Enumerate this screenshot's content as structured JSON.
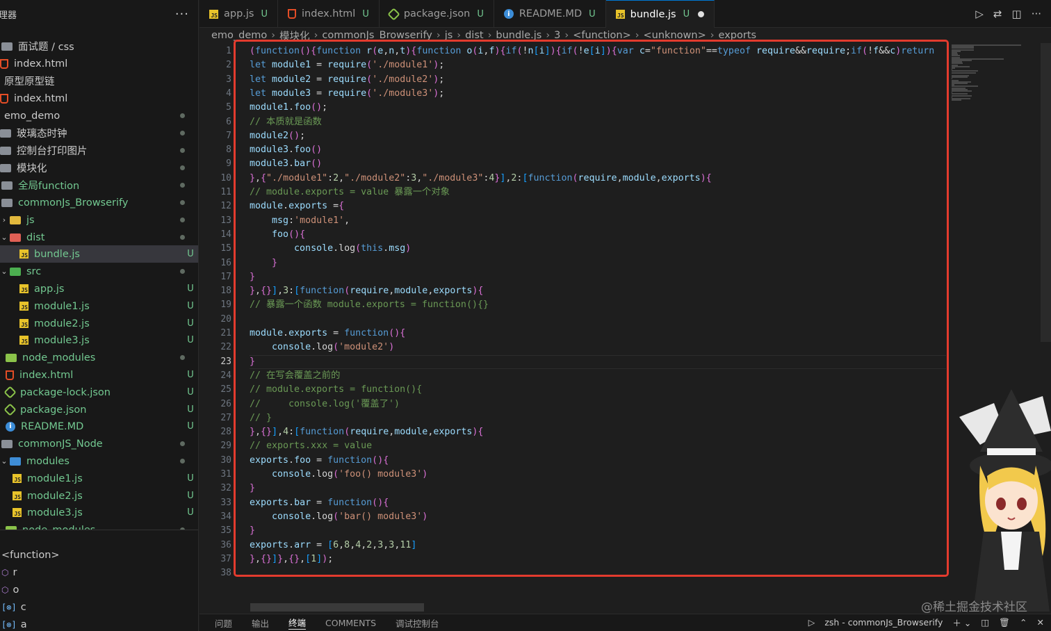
{
  "sidebar": {
    "title": "理器",
    "more": "···",
    "rows": [
      {
        "label": "面试题 / css",
        "icon": "folder-icon",
        "status": "",
        "type": "folder"
      },
      {
        "label": "index.html",
        "icon": "html-icon",
        "status": "",
        "type": "file"
      },
      {
        "label": "原型原型链",
        "icon": "",
        "status": "",
        "type": "folder"
      },
      {
        "label": "index.html",
        "icon": "html-icon",
        "status": "",
        "type": "file"
      },
      {
        "label": "emo_demo",
        "icon": "",
        "status": "dot",
        "type": "folder"
      },
      {
        "label": "玻璃态时钟",
        "icon": "folder-icon",
        "status": "dot",
        "type": "folder"
      },
      {
        "label": "控制台打印图片",
        "icon": "folder-icon",
        "status": "dot",
        "type": "folder"
      },
      {
        "label": "模块化",
        "icon": "folder-icon",
        "status": "dot",
        "type": "folder"
      },
      {
        "label": "全局function",
        "icon": "folder-icon",
        "status": "dot",
        "type": "folder"
      },
      {
        "label": "commonJs_Browserify",
        "icon": "folder-icon",
        "status": "dot",
        "type": "folder"
      },
      {
        "label": "js",
        "icon": "folder-js-icon",
        "status": "dot",
        "type": "folder"
      },
      {
        "label": "dist",
        "icon": "folder-dist-icon",
        "status": "dot",
        "type": "folder"
      },
      {
        "label": "bundle.js",
        "icon": "js-icon",
        "status": "U",
        "type": "file"
      },
      {
        "label": "src",
        "icon": "folder-src-icon",
        "status": "dot",
        "type": "folder"
      },
      {
        "label": "app.js",
        "icon": "js-icon",
        "status": "U",
        "type": "file"
      },
      {
        "label": "module1.js",
        "icon": "js-icon",
        "status": "U",
        "type": "file"
      },
      {
        "label": "module2.js",
        "icon": "js-icon",
        "status": "U",
        "type": "file"
      },
      {
        "label": "module3.js",
        "icon": "js-icon",
        "status": "U",
        "type": "file"
      },
      {
        "label": "node_modules",
        "icon": "folder-node-icon",
        "status": "dot",
        "type": "folder"
      },
      {
        "label": "index.html",
        "icon": "html-icon",
        "status": "U",
        "type": "file"
      },
      {
        "label": "package-lock.json",
        "icon": "json-icon",
        "status": "U",
        "type": "file"
      },
      {
        "label": "package.json",
        "icon": "json-icon",
        "status": "U",
        "type": "file"
      },
      {
        "label": "README.MD",
        "icon": "info-icon",
        "status": "U",
        "type": "file"
      },
      {
        "label": "commonJS_Node",
        "icon": "folder-icon",
        "status": "dot",
        "type": "folder"
      },
      {
        "label": "modules",
        "icon": "folder-modules-icon",
        "status": "dot",
        "type": "folder"
      },
      {
        "label": "module1.js",
        "icon": "js-icon",
        "status": "U",
        "type": "file"
      },
      {
        "label": "module2.js",
        "icon": "js-icon",
        "status": "U",
        "type": "file"
      },
      {
        "label": "module3.js",
        "icon": "js-icon",
        "status": "U",
        "type": "file"
      },
      {
        "label": "node_modules",
        "icon": "folder-node-icon",
        "status": "dot",
        "type": "folder"
      }
    ],
    "outline": [
      {
        "label": "<function>",
        "icon": ""
      },
      {
        "label": "r",
        "icon": "method-icon"
      },
      {
        "label": "o",
        "icon": "method-icon"
      },
      {
        "label": "c",
        "icon": "variable-icon"
      },
      {
        "label": "a",
        "icon": "variable-icon"
      }
    ]
  },
  "tabs": [
    {
      "label": "app.js",
      "icon": "js-icon",
      "status": "U"
    },
    {
      "label": "index.html",
      "icon": "html-icon",
      "status": "U"
    },
    {
      "label": "package.json",
      "icon": "json-icon",
      "status": "U"
    },
    {
      "label": "README.MD",
      "icon": "info-icon",
      "status": "U"
    },
    {
      "label": "bundle.js",
      "icon": "js-icon",
      "status": "U",
      "active": true,
      "modified": true
    }
  ],
  "tab_actions": {
    "run": "▷",
    "compare": "⇄",
    "split": "◫",
    "more": "···"
  },
  "breadcrumb": [
    "emo_demo",
    "模块化",
    "commonJs_Browserify",
    "js",
    "dist",
    "bundle.js",
    "3",
    "<function>",
    "<unknown>",
    "exports"
  ],
  "editor": {
    "current_line": 23,
    "lines": [
      "(function(){function r(e,n,t){function o(i,f){if(!n[i]){if(!e[i]){var c=\"function\"==typeof require&&require;if(!f&&c)return",
      "let module1 = require('./module1');",
      "let module2 = require('./module2');",
      "let module3 = require('./module3');",
      "module1.foo();",
      "// 本质就是函数",
      "module2();",
      "module3.foo()",
      "module3.bar()",
      "},{\"./module1\":2,\"./module2\":3,\"./module3\":4}],2:[function(require,module,exports){",
      "// module.exports = value 暴露一个对象",
      "module.exports ={",
      "    msg:'module1',",
      "    foo(){",
      "        console.log(this.msg)",
      "    }",
      "}",
      "},{}],3:[function(require,module,exports){",
      "// 暴露一个函数 module.exports = function(){}",
      "",
      "module.exports = function(){",
      "    console.log('module2')",
      "}",
      "// 在写会覆盖之前的",
      "// module.exports = function(){",
      "//     console.log('覆盖了')",
      "// }",
      "},{}],4:[function(require,module,exports){",
      "// exports.xxx = value",
      "exports.foo = function(){",
      "    console.log('foo() module3')",
      "}",
      "exports.bar = function(){",
      "    console.log('bar() module3')",
      "}",
      "exports.arr = [6,8,4,2,3,3,11]",
      "},{}]},{},[1]);",
      ""
    ]
  },
  "panel": {
    "tabs": [
      "问题",
      "输出",
      "终端",
      "COMMENTS",
      "调试控制台"
    ],
    "active": "终端",
    "terminal_label": "zsh - commonJs_Browserify"
  },
  "watermark": "@稀土掘金技术社区",
  "colors": {
    "highlight": "#e33b2e",
    "git_untracked": "#73c991",
    "accent": "#0078d4"
  }
}
